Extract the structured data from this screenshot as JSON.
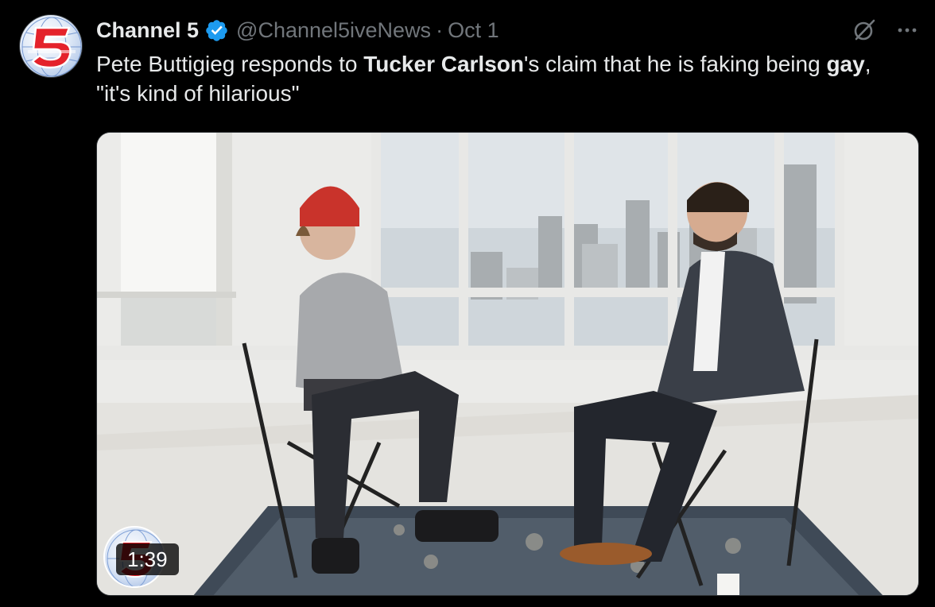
{
  "tweet": {
    "author": {
      "display_name": "Channel 5",
      "handle": "@Channel5iveNews",
      "verified": true,
      "avatar_icon": "channel-5-logo"
    },
    "separator": "·",
    "date": "Oct 1",
    "text_segments": [
      {
        "text": "Pete Buttigieg responds to ",
        "bold": false
      },
      {
        "text": "Tucker Carlson",
        "bold": true
      },
      {
        "text": "'s claim that he is faking being ",
        "bold": false
      },
      {
        "text": "gay",
        "bold": true
      },
      {
        "text": ", \"it's kind of hilarious\"",
        "bold": false
      }
    ],
    "media": {
      "type": "video",
      "duration": "1:39"
    },
    "actions": {
      "grok_icon": "grok-icon",
      "more_icon": "more-icon"
    }
  },
  "colors": {
    "background": "#000000",
    "text_primary": "#e7e9ea",
    "text_secondary": "#71767b",
    "verified_blue": "#1d9bf0",
    "logo_red": "#e4222b"
  }
}
